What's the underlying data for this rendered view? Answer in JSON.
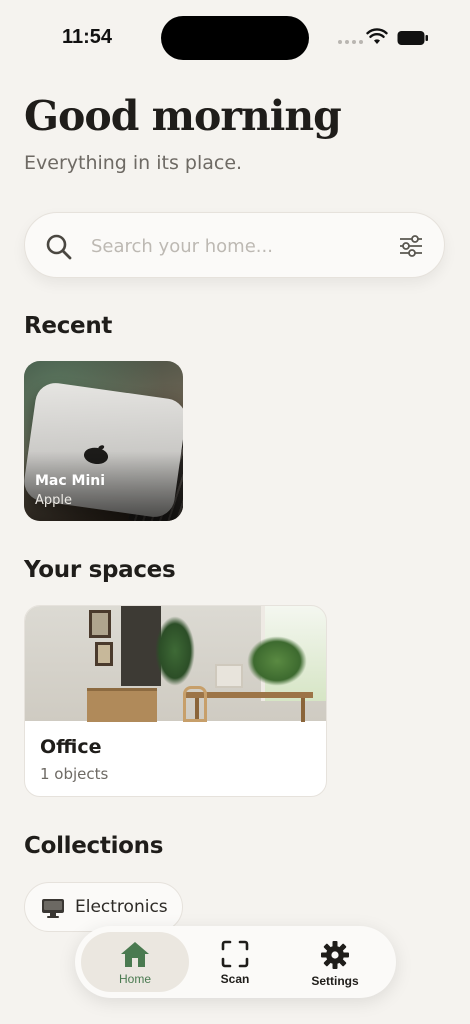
{
  "status_bar": {
    "time": "11:54"
  },
  "header": {
    "greeting": "Good morning",
    "subtitle": "Everything in its place."
  },
  "search": {
    "placeholder": "Search your home...",
    "icon": "search-icon",
    "filter_icon": "sliders-icon"
  },
  "recent": {
    "title": "Recent",
    "items": [
      {
        "name": "Mac Mini",
        "brand": "Apple"
      }
    ]
  },
  "spaces": {
    "title": "Your spaces",
    "items": [
      {
        "name": "Office",
        "count": "1 objects"
      }
    ]
  },
  "collections": {
    "title": "Collections",
    "items": [
      {
        "label": "Electronics",
        "icon": "monitor-icon"
      }
    ]
  },
  "tab_bar": {
    "tabs": [
      {
        "label": "Home",
        "icon": "home-icon",
        "active": true
      },
      {
        "label": "Scan",
        "icon": "scan-icon",
        "active": false
      },
      {
        "label": "Settings",
        "icon": "gear-icon",
        "active": false
      }
    ]
  },
  "colors": {
    "background": "#f5f3ef",
    "accent": "#4a7a50",
    "text_primary": "#1f1d1a",
    "text_secondary": "#6e6a64"
  }
}
